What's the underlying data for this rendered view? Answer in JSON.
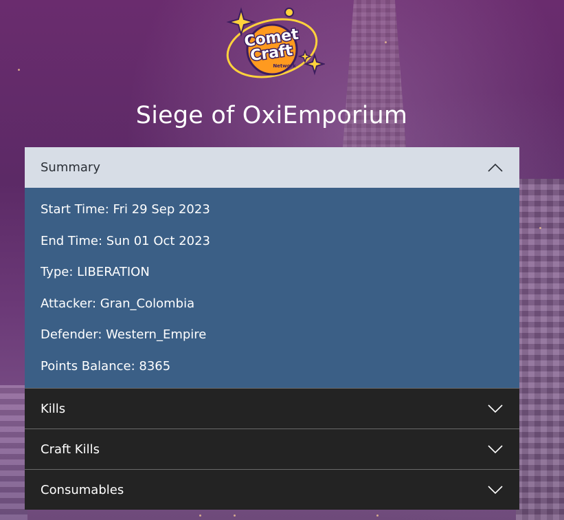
{
  "logo": {
    "line1": "Comet",
    "line2": "Craft",
    "tag": "Network",
    "colors": {
      "orange": "#ff9a1f",
      "gold": "#ffd23c",
      "outline": "#3b1d5e"
    }
  },
  "page_title": "Siege of OxiEmporium",
  "accordion": {
    "summary": {
      "label": "Summary",
      "expanded": true,
      "rows": {
        "start_time": "Start Time: Fri 29 Sep 2023",
        "end_time": "End Time: Sun 01 Oct 2023",
        "type": "Type: LIBERATION",
        "attacker": "Attacker: Gran_Colombia",
        "defender": "Defender: Western_Empire",
        "points_balance": "Points Balance: 8365"
      }
    },
    "kills": {
      "label": "Kills",
      "expanded": false
    },
    "craft_kills": {
      "label": "Craft Kills",
      "expanded": false
    },
    "consumables": {
      "label": "Consumables",
      "expanded": false
    }
  },
  "icons": {
    "expanded": "chevron-up-icon",
    "collapsed": "chevron-down-icon"
  },
  "colors": {
    "header_open_bg": "#d7dde6",
    "body_bg": "#3b5f86",
    "header_closed_bg": "#232323",
    "background": "#5a2a63"
  }
}
